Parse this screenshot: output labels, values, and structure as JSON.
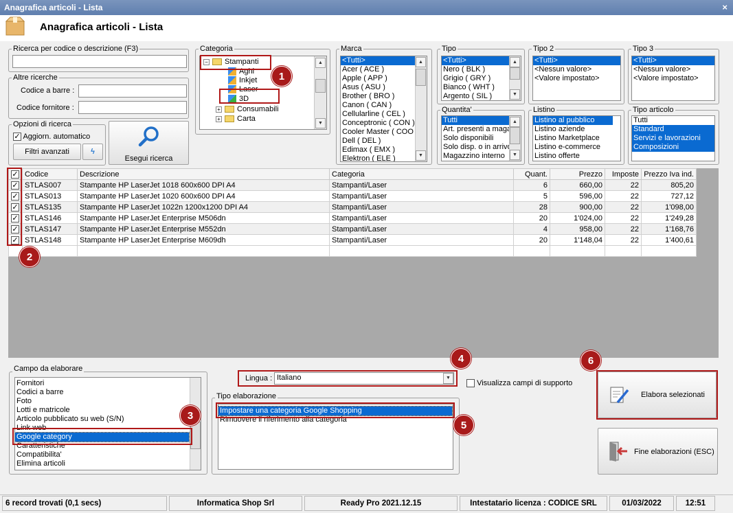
{
  "window": {
    "title": "Anagrafica articoli  - Lista",
    "close": "×"
  },
  "header": {
    "title": "Anagrafica articoli  - Lista"
  },
  "search": {
    "group_label": "Ricerca per codice o descrizione (F3)",
    "value": "",
    "other_label": "Altre ricerche",
    "barcode_label": "Codice a barre :",
    "supplier_code_label": "Codice fornitore :"
  },
  "options": {
    "group_label": "Opzioni di ricerca",
    "auto_update_label": "Aggiorn. automatico",
    "auto_update_checked": true,
    "advanced_filters_label": "Filtri avanzati",
    "execute_search_label": "Esegui ricerca"
  },
  "categoria": {
    "label": "Categoria",
    "tree": [
      {
        "label": "Stampanti",
        "level": 0,
        "type": "folder",
        "expander": "−"
      },
      {
        "label": "Aghi",
        "level": 1,
        "type": "leaf"
      },
      {
        "label": "Inkjet",
        "level": 1,
        "type": "leaf"
      },
      {
        "label": "Laser",
        "level": 1,
        "type": "leaf",
        "selected": true
      },
      {
        "label": "3D",
        "level": 1,
        "type": "leaf"
      },
      {
        "label": "Consumabili",
        "level": 0,
        "type": "folder",
        "expander": "+"
      },
      {
        "label": "Carta",
        "level": 0,
        "type": "folder",
        "expander": "+"
      }
    ]
  },
  "marca": {
    "label": "Marca",
    "items": [
      "<Tutti>",
      "Acer ( ACE )",
      "Apple ( APP )",
      "Asus ( ASU )",
      "Brother ( BRO )",
      "Canon ( CAN )",
      "Cellularline ( CEL )",
      "Conceptronic ( CON )",
      "Cooler Master ( COO )",
      "Dell ( DEL )",
      "Edimax ( EMX )",
      "Elektron ( ELE )"
    ]
  },
  "tipo": {
    "label": "Tipo",
    "items": [
      "<Tutti>",
      "Nero ( BLK )",
      "Grigio ( GRY )",
      "Bianco ( WHT )",
      "Argento ( SIL )"
    ]
  },
  "tipo2": {
    "label": "Tipo 2",
    "items": [
      "<Tutti>",
      "<Nessun valore>",
      "<Valore impostato>"
    ]
  },
  "tipo3": {
    "label": "Tipo 3",
    "items": [
      "<Tutti>",
      "<Nessun valore>",
      "<Valore impostato>"
    ]
  },
  "quantita": {
    "label": "Quantita'",
    "items": [
      "Tutti",
      "Art. presenti a magazzino",
      "Solo disponibili",
      "Solo disp. o in arrivo",
      "Magazzino interno"
    ]
  },
  "listino": {
    "label": "Listino",
    "items": [
      "Listino al pubblico",
      "Listino aziende",
      "Listino Marketplace",
      "Listino e-commerce",
      "Listino offerte"
    ]
  },
  "tipo_articolo": {
    "label": "Tipo articolo",
    "items": [
      "Tutti",
      "Standard",
      "Servizi e lavorazioni",
      "Composizioni"
    ]
  },
  "grid": {
    "columns": [
      "Codice",
      "Descrizione",
      "Categoria",
      "Quant.",
      "Prezzo",
      "Imposte",
      "Prezzo Iva ind."
    ],
    "rows": [
      {
        "checked": true,
        "codice": "STLAS007",
        "descrizione": "Stampante HP LaserJet 1018 600x600 DPI A4",
        "categoria": "Stampanti/Laser",
        "quant": "6",
        "prezzo": "660,00",
        "imposte": "22",
        "prezzo_iva": "805,20"
      },
      {
        "checked": true,
        "codice": "STLAS013",
        "descrizione": "Stampante HP LaserJet 1020 600x600 DPI A4",
        "categoria": "Stampanti/Laser",
        "quant": "5",
        "prezzo": "596,00",
        "imposte": "22",
        "prezzo_iva": "727,12"
      },
      {
        "checked": true,
        "codice": "STLAS135",
        "descrizione": "Stampante HP LaserJet 1022n 1200x1200 DPI A4",
        "categoria": "Stampanti/Laser",
        "quant": "28",
        "prezzo": "900,00",
        "imposte": "22",
        "prezzo_iva": "1'098,00"
      },
      {
        "checked": true,
        "codice": "STLAS146",
        "descrizione": "Stampante HP LaserJet Enterprise M506dn",
        "categoria": "Stampanti/Laser",
        "quant": "20",
        "prezzo": "1'024,00",
        "imposte": "22",
        "prezzo_iva": "1'249,28"
      },
      {
        "checked": true,
        "codice": "STLAS147",
        "descrizione": "Stampante HP LaserJet Enterprise M552dn",
        "categoria": "Stampanti/Laser",
        "quant": "4",
        "prezzo": "958,00",
        "imposte": "22",
        "prezzo_iva": "1'168,76"
      },
      {
        "checked": true,
        "codice": "STLAS148",
        "descrizione": "Stampante HP LaserJet Enterprise M609dh",
        "categoria": "Stampanti/Laser",
        "quant": "20",
        "prezzo": "1'148,04",
        "imposte": "22",
        "prezzo_iva": "1'400,61"
      }
    ]
  },
  "campo": {
    "label": "Campo da elaborare",
    "items": [
      "Fornitori",
      "Codici a barre",
      "Foto",
      "Lotti e matricole",
      "Articolo pubblicato su web (S/N)",
      "Link web",
      "Google category",
      "Caratteristiche",
      "Compatibilita'",
      "Elimina articoli"
    ],
    "selected": "Google category"
  },
  "lingua": {
    "label": "Lingua :",
    "value": "Italiano"
  },
  "support_fields_label": "Visualizza campi di supporto",
  "tipo_elab": {
    "label": "Tipo elaborazione",
    "items": [
      "Impostare una categoria Google Shopping",
      "Rimuovere il riferimento alla categoria"
    ]
  },
  "actions": {
    "process_label": "Elabora selezionati",
    "end_label": "Fine elaborazioni (ESC)"
  },
  "badges": [
    "1",
    "2",
    "3",
    "4",
    "5",
    "6"
  ],
  "status": {
    "records": "6 record trovati (0,1 secs)",
    "company": "Informatica Shop Srl",
    "version": "Ready Pro 2021.12.15",
    "license": "Intestatario licenza : CODICE SRL",
    "date": "01/03/2022",
    "time": "12:51"
  }
}
